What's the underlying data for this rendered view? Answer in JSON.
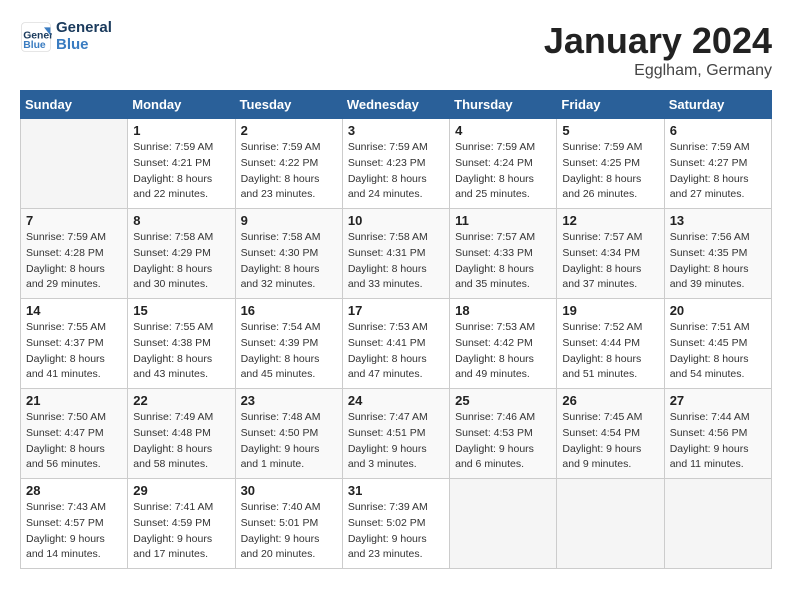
{
  "header": {
    "logo_line1": "General",
    "logo_line2": "Blue",
    "month_title": "January 2024",
    "location": "Egglham, Germany"
  },
  "weekdays": [
    "Sunday",
    "Monday",
    "Tuesday",
    "Wednesday",
    "Thursday",
    "Friday",
    "Saturday"
  ],
  "weeks": [
    [
      {
        "day": "",
        "info": ""
      },
      {
        "day": "1",
        "info": "Sunrise: 7:59 AM\nSunset: 4:21 PM\nDaylight: 8 hours\nand 22 minutes."
      },
      {
        "day": "2",
        "info": "Sunrise: 7:59 AM\nSunset: 4:22 PM\nDaylight: 8 hours\nand 23 minutes."
      },
      {
        "day": "3",
        "info": "Sunrise: 7:59 AM\nSunset: 4:23 PM\nDaylight: 8 hours\nand 24 minutes."
      },
      {
        "day": "4",
        "info": "Sunrise: 7:59 AM\nSunset: 4:24 PM\nDaylight: 8 hours\nand 25 minutes."
      },
      {
        "day": "5",
        "info": "Sunrise: 7:59 AM\nSunset: 4:25 PM\nDaylight: 8 hours\nand 26 minutes."
      },
      {
        "day": "6",
        "info": "Sunrise: 7:59 AM\nSunset: 4:27 PM\nDaylight: 8 hours\nand 27 minutes."
      }
    ],
    [
      {
        "day": "7",
        "info": "Sunrise: 7:59 AM\nSunset: 4:28 PM\nDaylight: 8 hours\nand 29 minutes."
      },
      {
        "day": "8",
        "info": "Sunrise: 7:58 AM\nSunset: 4:29 PM\nDaylight: 8 hours\nand 30 minutes."
      },
      {
        "day": "9",
        "info": "Sunrise: 7:58 AM\nSunset: 4:30 PM\nDaylight: 8 hours\nand 32 minutes."
      },
      {
        "day": "10",
        "info": "Sunrise: 7:58 AM\nSunset: 4:31 PM\nDaylight: 8 hours\nand 33 minutes."
      },
      {
        "day": "11",
        "info": "Sunrise: 7:57 AM\nSunset: 4:33 PM\nDaylight: 8 hours\nand 35 minutes."
      },
      {
        "day": "12",
        "info": "Sunrise: 7:57 AM\nSunset: 4:34 PM\nDaylight: 8 hours\nand 37 minutes."
      },
      {
        "day": "13",
        "info": "Sunrise: 7:56 AM\nSunset: 4:35 PM\nDaylight: 8 hours\nand 39 minutes."
      }
    ],
    [
      {
        "day": "14",
        "info": "Sunrise: 7:55 AM\nSunset: 4:37 PM\nDaylight: 8 hours\nand 41 minutes."
      },
      {
        "day": "15",
        "info": "Sunrise: 7:55 AM\nSunset: 4:38 PM\nDaylight: 8 hours\nand 43 minutes."
      },
      {
        "day": "16",
        "info": "Sunrise: 7:54 AM\nSunset: 4:39 PM\nDaylight: 8 hours\nand 45 minutes."
      },
      {
        "day": "17",
        "info": "Sunrise: 7:53 AM\nSunset: 4:41 PM\nDaylight: 8 hours\nand 47 minutes."
      },
      {
        "day": "18",
        "info": "Sunrise: 7:53 AM\nSunset: 4:42 PM\nDaylight: 8 hours\nand 49 minutes."
      },
      {
        "day": "19",
        "info": "Sunrise: 7:52 AM\nSunset: 4:44 PM\nDaylight: 8 hours\nand 51 minutes."
      },
      {
        "day": "20",
        "info": "Sunrise: 7:51 AM\nSunset: 4:45 PM\nDaylight: 8 hours\nand 54 minutes."
      }
    ],
    [
      {
        "day": "21",
        "info": "Sunrise: 7:50 AM\nSunset: 4:47 PM\nDaylight: 8 hours\nand 56 minutes."
      },
      {
        "day": "22",
        "info": "Sunrise: 7:49 AM\nSunset: 4:48 PM\nDaylight: 8 hours\nand 58 minutes."
      },
      {
        "day": "23",
        "info": "Sunrise: 7:48 AM\nSunset: 4:50 PM\nDaylight: 9 hours\nand 1 minute."
      },
      {
        "day": "24",
        "info": "Sunrise: 7:47 AM\nSunset: 4:51 PM\nDaylight: 9 hours\nand 3 minutes."
      },
      {
        "day": "25",
        "info": "Sunrise: 7:46 AM\nSunset: 4:53 PM\nDaylight: 9 hours\nand 6 minutes."
      },
      {
        "day": "26",
        "info": "Sunrise: 7:45 AM\nSunset: 4:54 PM\nDaylight: 9 hours\nand 9 minutes."
      },
      {
        "day": "27",
        "info": "Sunrise: 7:44 AM\nSunset: 4:56 PM\nDaylight: 9 hours\nand 11 minutes."
      }
    ],
    [
      {
        "day": "28",
        "info": "Sunrise: 7:43 AM\nSunset: 4:57 PM\nDaylight: 9 hours\nand 14 minutes."
      },
      {
        "day": "29",
        "info": "Sunrise: 7:41 AM\nSunset: 4:59 PM\nDaylight: 9 hours\nand 17 minutes."
      },
      {
        "day": "30",
        "info": "Sunrise: 7:40 AM\nSunset: 5:01 PM\nDaylight: 9 hours\nand 20 minutes."
      },
      {
        "day": "31",
        "info": "Sunrise: 7:39 AM\nSunset: 5:02 PM\nDaylight: 9 hours\nand 23 minutes."
      },
      {
        "day": "",
        "info": ""
      },
      {
        "day": "",
        "info": ""
      },
      {
        "day": "",
        "info": ""
      }
    ]
  ]
}
